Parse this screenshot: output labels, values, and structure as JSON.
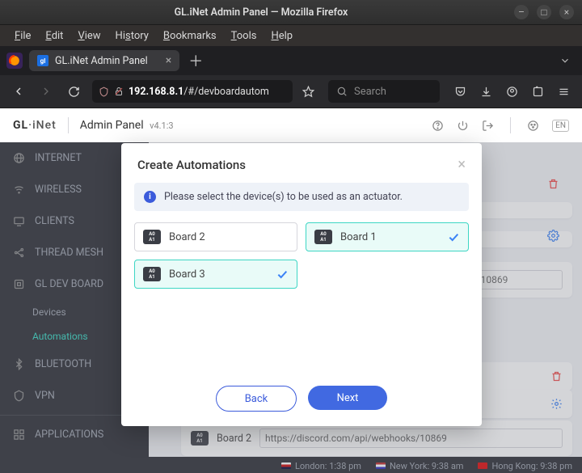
{
  "window": {
    "title": "GL.iNet Admin Panel — Mozilla Firefox"
  },
  "menu": {
    "file": "File",
    "edit": "Edit",
    "view": "View",
    "history": "History",
    "bookmarks": "Bookmarks",
    "tools": "Tools",
    "help": "Help"
  },
  "tab": {
    "label": "GL.iNet Admin Panel"
  },
  "url": {
    "host": "192.168.8.1",
    "path": "/#/devboardautom"
  },
  "search": {
    "placeholder": "Search"
  },
  "app": {
    "brand_a": "GL",
    "brand_b": "iNet",
    "panel_label": "Admin Panel",
    "panel_version": "v4.1:3",
    "lang": "EN"
  },
  "sidebar": {
    "internet": "INTERNET",
    "wireless": "WIRELESS",
    "clients": "CLIENTS",
    "threadmesh": "THREAD MESH",
    "gldev": "GL DEV BOARD",
    "devices": "Devices",
    "automations": "Automations",
    "bluetooth": "BLUETOOTH",
    "vpn": "VPN",
    "applications": "APPLICATIONS"
  },
  "content": {
    "webhook1": "webhooks/10869",
    "webhook2": "https://discord.com/api/webhooks/10869",
    "board2": "Board 2"
  },
  "footer": {
    "london_label": "London:",
    "london_time": "1:38 pm",
    "ny_label": "New York:",
    "ny_time": "9:38 am",
    "hk_label": "Hong Kong:",
    "hk_time": "9:38 pm"
  },
  "modal": {
    "title": "Create Automations",
    "info": "Please select the device(s) to be used as an actuator.",
    "devices": [
      {
        "name": "Board 2",
        "selected": false
      },
      {
        "name": "Board 1",
        "selected": true
      },
      {
        "name": "Board 3",
        "selected": true
      }
    ],
    "back": "Back",
    "next": "Next"
  },
  "boardicon": {
    "a": "A0",
    "b": "A1"
  }
}
